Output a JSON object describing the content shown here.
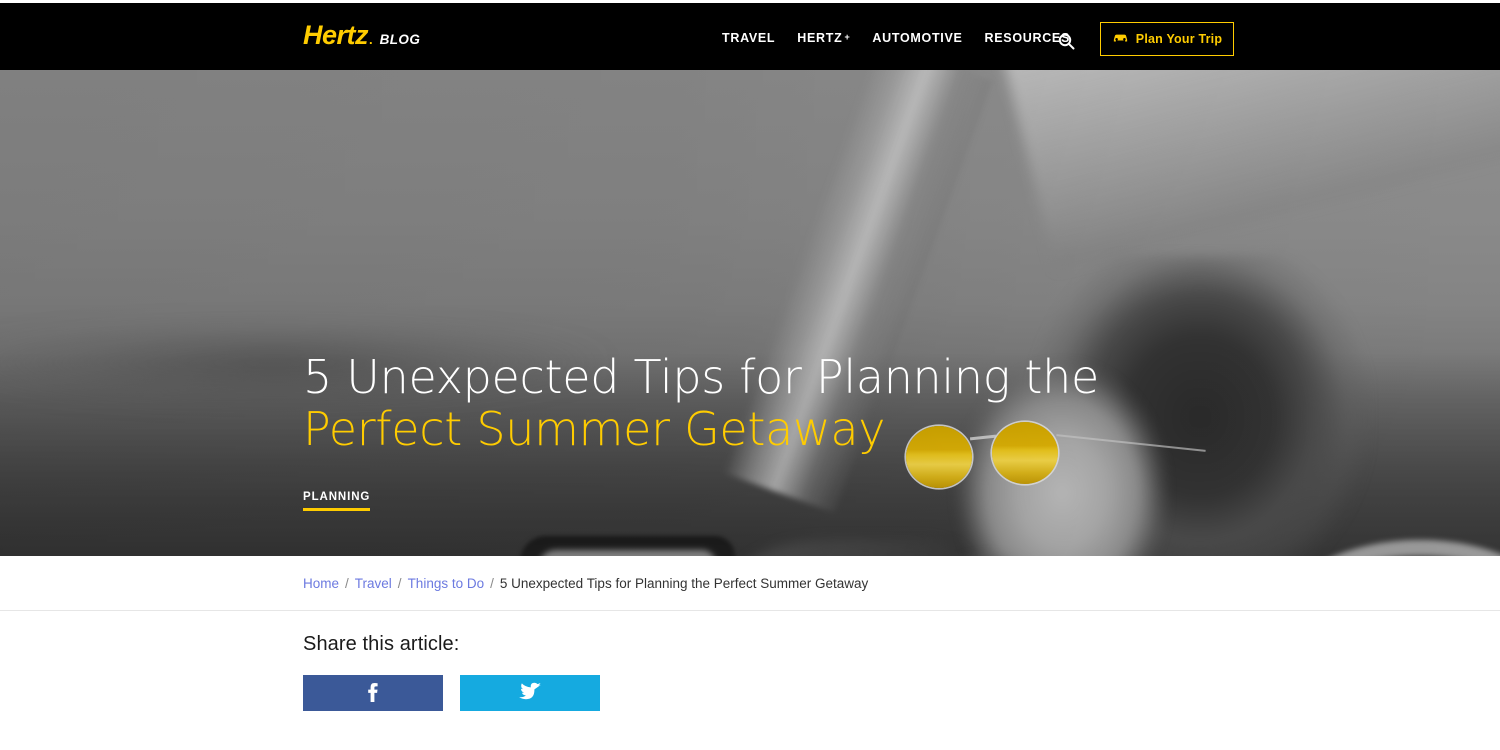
{
  "header": {
    "brand": {
      "name": "Hertz",
      "dot": ".",
      "suffix": "BLOG"
    },
    "nav": [
      {
        "label": "TRAVEL",
        "caret": ""
      },
      {
        "label": "HERTZ",
        "caret": "+"
      },
      {
        "label": "AUTOMOTIVE",
        "caret": ""
      },
      {
        "label": "RESOURCES",
        "caret": ""
      }
    ],
    "search_icon": "search-icon",
    "cta": {
      "label": "Plan Your Trip",
      "icon": "car-icon"
    },
    "background_color": "#000000",
    "accent_color": "#FFCC00"
  },
  "hero": {
    "title_line_1": "5 Unexpected Tips for Planning the",
    "title_line_2": "Perfect Summer Getaway",
    "tag": "PLANNING",
    "title_color_line_1": "#FFFFFF",
    "title_color_line_2": "#FFCC00",
    "tag_underline_color": "#FFCC00",
    "image_description": "black-and-white photo of a woman driving a car wearing yellow-tinted sunglasses"
  },
  "breadcrumb": {
    "separator": "/",
    "items": [
      {
        "label": "Home",
        "is_link": true
      },
      {
        "label": "Travel",
        "is_link": true
      },
      {
        "label": "Things to Do",
        "is_link": true
      },
      {
        "label": "5 Unexpected Tips for Planning the Perfect Summer Getaway",
        "is_link": false
      }
    ],
    "link_color": "#6C7AE0"
  },
  "share": {
    "heading": "Share this article:",
    "buttons": [
      {
        "network": "facebook",
        "icon": "facebook-icon",
        "color": "#3B5998"
      },
      {
        "network": "twitter",
        "icon": "twitter-icon",
        "color": "#15AAE0"
      }
    ]
  }
}
